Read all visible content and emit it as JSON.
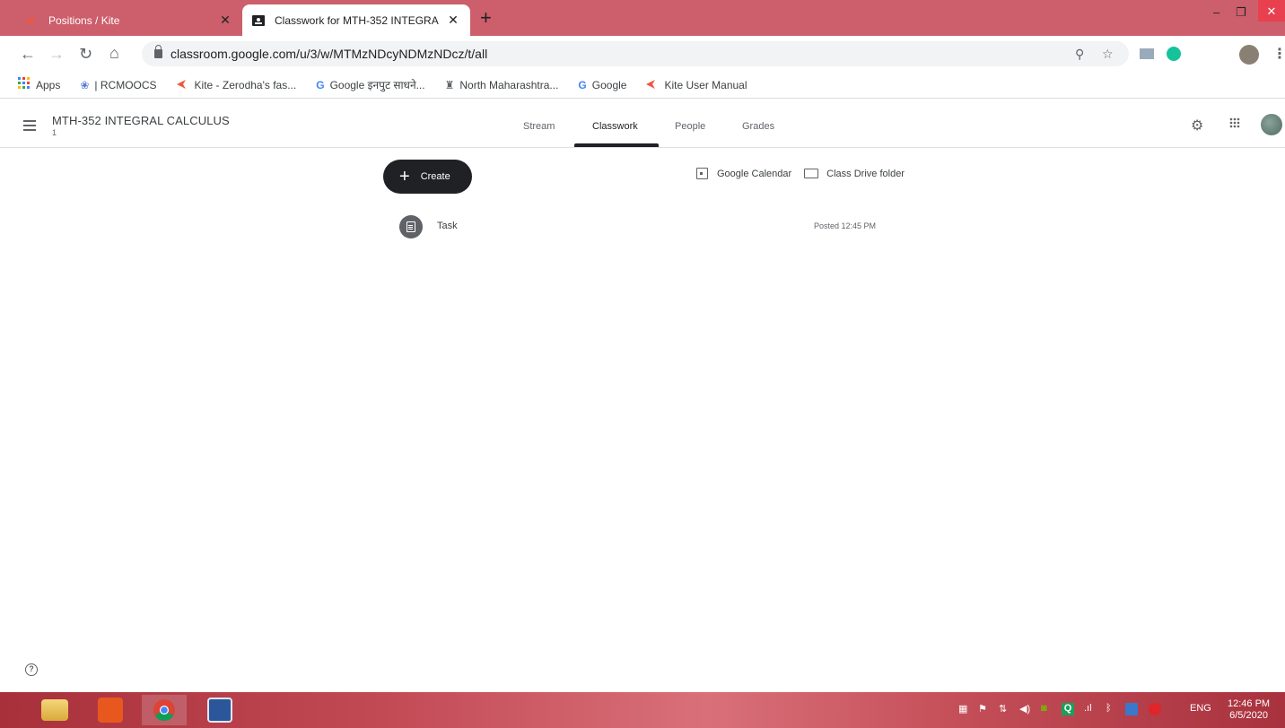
{
  "browser": {
    "tabs": [
      {
        "title": "Positions / Kite",
        "active": false
      },
      {
        "title": "Classwork for MTH-352 INTEGRA",
        "active": true
      }
    ],
    "new_tab": "+",
    "url": "classroom.google.com/u/3/w/MTMzNDcyNDMzNDcz/t/all",
    "window_minimize": "–",
    "window_restore": "❐",
    "window_close": "✕"
  },
  "bookmarks": [
    {
      "label": "Apps",
      "icon": "apps-grid-icon"
    },
    {
      "label": "| RCMOOCS",
      "icon": "globe-icon"
    },
    {
      "label": "Kite - Zerodha's fas...",
      "icon": "kite-icon"
    },
    {
      "label": "Google इनपुट साधने...",
      "icon": "google-icon"
    },
    {
      "label": "North Maharashtra...",
      "icon": "university-icon"
    },
    {
      "label": "Google",
      "icon": "google-icon"
    },
    {
      "label": "Kite User Manual",
      "icon": "kite-icon"
    }
  ],
  "classroom": {
    "course_title": "MTH-352 INTEGRAL CALCULUS",
    "course_subtitle": "1",
    "tabs": [
      {
        "label": "Stream"
      },
      {
        "label": "Classwork"
      },
      {
        "label": "People"
      },
      {
        "label": "Grades"
      }
    ],
    "active_tab": "Classwork",
    "create_label": "Create",
    "links": {
      "calendar": "Google Calendar",
      "drive": "Class Drive folder"
    },
    "items": [
      {
        "title": "Task",
        "posted": "Posted 12:45 PM"
      }
    ],
    "help": "?"
  },
  "taskbar": {
    "language": "ENG",
    "time": "12:46 PM",
    "date": "6/5/2020"
  },
  "colors": {
    "tab_strip": "#cd5e6b",
    "create_button": "#202124"
  }
}
